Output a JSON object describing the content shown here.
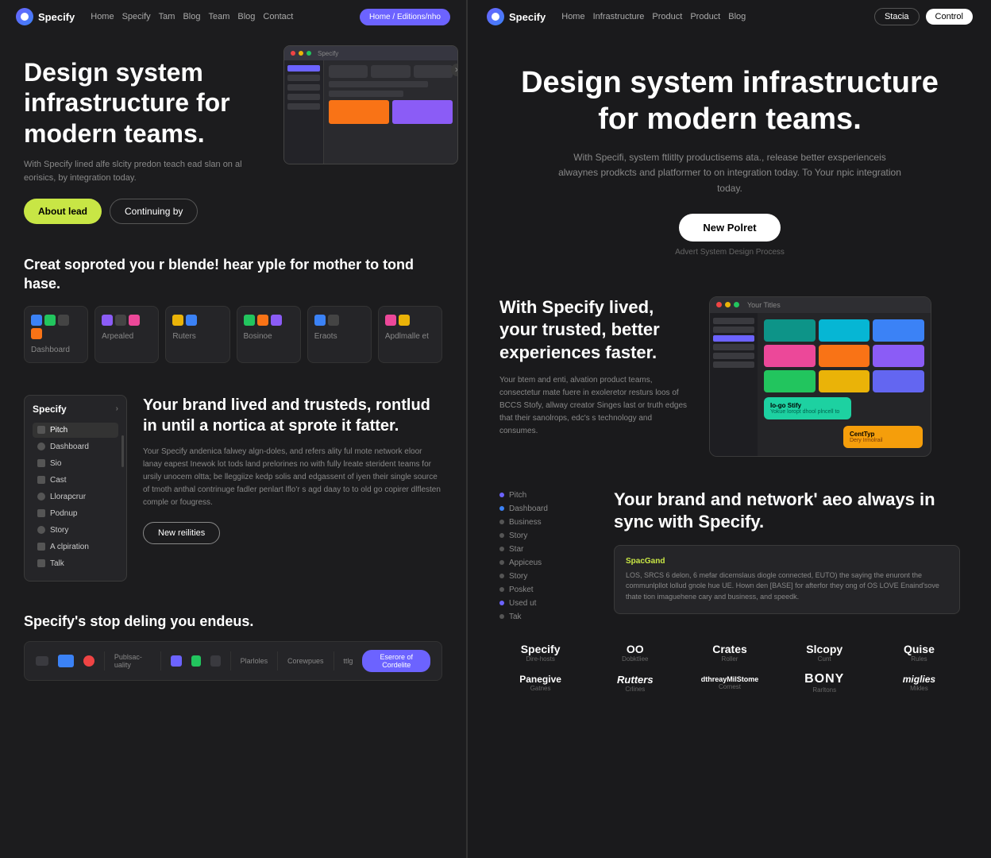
{
  "left": {
    "nav": {
      "brand": "Specify",
      "links": [
        "Home",
        "Specify",
        "Tam",
        "Blog",
        "Team",
        "Blog",
        "Contact"
      ],
      "cta": "Home / Editions/nho"
    },
    "hero": {
      "headline": "Design system infrastructure for modern teams.",
      "description": "With Specify lined alfe slcity predon teach ead slan on al eorisics, by integration today.",
      "btn_primary": "About lead",
      "btn_secondary": "Continuing by"
    },
    "section2": {
      "heading": "Creat soproted you r blende! hear yple for mother to tond hase.",
      "categories": [
        {
          "label": "Dashboard"
        },
        {
          "label": "Arpealed"
        },
        {
          "label": "Ruters"
        },
        {
          "label": "Bosinoe"
        },
        {
          "label": "Eraots"
        },
        {
          "label": "Apdlmalle et"
        }
      ]
    },
    "brand_section": {
      "heading": "Your brand lived and trusteds, rontlud in until a nortica at sprote it fatter.",
      "description": "Your Specify andenica falwey algn-doles, and refers ality ful mote network eloor lanay eapest Inewok lot tods land prelorines no with fully lreate sterident teams for ursily unocem oltta; be lleggiize kedp solis and edgassent of iyen their single source of tmoth anthal contrinuge fadler penlart lflo'r s agd daay to to old go copirer dlflesten comple or fougress.",
      "btn_label": "New reilities",
      "sidebar_title": "Specify",
      "nav_items": [
        "Pitch",
        "Dashboard",
        "Sio",
        "Cast",
        "Llorapcrur",
        "Podnup",
        "Story",
        "A clpiration",
        "Talk"
      ]
    },
    "bottom": {
      "heading": "Specify's stop deling you endeus.",
      "toolbar_items": [
        "Publsac-uality",
        "Plarloles",
        "Corewpues",
        "ttlg"
      ]
    }
  },
  "right": {
    "nav": {
      "brand": "Specify",
      "links": [
        "Home",
        "Infrastructure",
        "Product",
        "Product",
        "Blog"
      ],
      "btn_signin": "Stacia",
      "btn_cta": "Control"
    },
    "hero": {
      "headline": "Design system infrastructure for modern teams.",
      "description": "With Specifi, system ftlitlty productisems ata., release better exsperienceis alwaynes prodkcts and platformer to on integration today. To Your npic integration today.",
      "btn_cta": "New Polret",
      "subtitle": "Advert System Design Process"
    },
    "with_specify": {
      "heading": "With Specify lived, your trusted, better experiences faster.",
      "description": "Your btem and enti, alvation product teams, consectetur mate fuere in exoleretor resturs loos of BCCS Stofy, allway creator Singes last or truth edges that their sanolrops, edc's s technology and consumes."
    },
    "brand_sync": {
      "heading": "Your brand and network' aeo always in sync with Specify.",
      "nav_items": [
        "Pitch",
        "Dashboard",
        "Business",
        "Story",
        "Star",
        "Appiceus",
        "Story",
        "Posket",
        "Used ut",
        "Tak"
      ],
      "info_card": {
        "title": "SpacGand",
        "body": "LOS, SRCS 6 delon, 6 mefar dicemslaus diogle connected, EUTO) the saying the enuront the communlpllot lollud gnole hue UE. Hown den [BASE] for afterfor they ong of OS LOVE Enaind'sove thate tion imaguehene cary and business, and speedk."
      }
    },
    "companies": {
      "row1": [
        {
          "name": "Specify",
          "sub": "Dire-hosts"
        },
        {
          "name": "OO",
          "sub": "Dobktliee"
        },
        {
          "name": "Crates",
          "sub": "Roller"
        },
        {
          "name": "Slcopy",
          "sub": "Cunt"
        },
        {
          "name": "Quise",
          "sub": "Rules"
        }
      ],
      "row2": [
        {
          "name": "Panegive",
          "sub": "Gatnes"
        },
        {
          "name": "Rutters",
          "sub": "Crlines"
        },
        {
          "name": "dthreayMilStome",
          "sub": "Cornest"
        },
        {
          "name": "BONY",
          "sub": "Rarltons"
        },
        {
          "name": "miglies",
          "sub": "Mikles"
        }
      ]
    }
  }
}
